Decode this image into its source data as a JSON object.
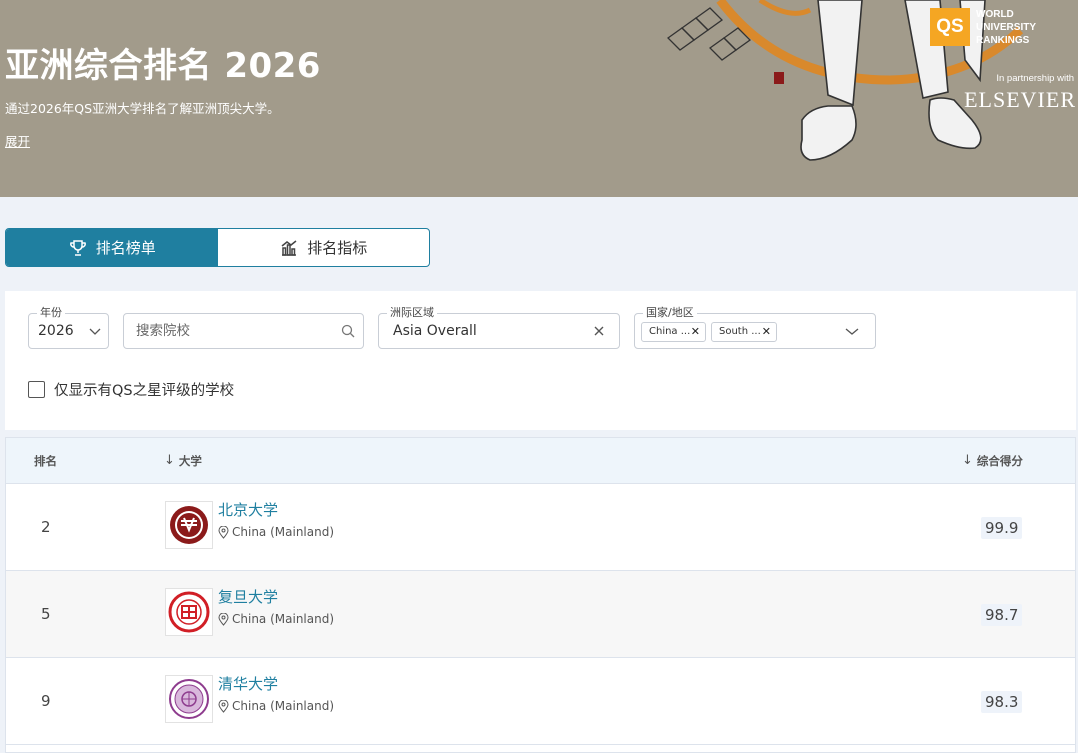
{
  "hero": {
    "title": "亚洲综合排名 2026",
    "description": "通过2026年QS亚洲大学排名了解亚洲顶尖大学。",
    "expand_label": "展开",
    "qs_logo": {
      "mark": "QS",
      "line1": "WORLD",
      "line2": "UNIVERSITY",
      "line3": "RANKINGS"
    },
    "partner_text": "In partnership with",
    "partner_name": "ELSEVIER"
  },
  "tabs": [
    {
      "label": "排名榜单",
      "icon": "trophy-icon",
      "active": true
    },
    {
      "label": "排名指标",
      "icon": "bar-chart-icon",
      "active": false
    }
  ],
  "filters": {
    "year": {
      "label": "年份",
      "value": "2026"
    },
    "search": {
      "placeholder": "搜索院校"
    },
    "region": {
      "label": "洲际区域",
      "value": "Asia Overall"
    },
    "country": {
      "label": "国家/地区",
      "chips": [
        "China ...",
        "South ..."
      ]
    },
    "star_checkbox_label": "仅显示有QS之星评级的学校"
  },
  "table": {
    "headers": {
      "rank": "排名",
      "university": "大学",
      "score": "综合得分"
    },
    "rows": [
      {
        "rank": "2",
        "name": "北京大学",
        "location": "China (Mainland)",
        "score": "99.9",
        "logo": "pku-seal-icon"
      },
      {
        "rank": "5",
        "name": "复旦大学",
        "location": "China (Mainland)",
        "score": "98.7",
        "logo": "fudan-seal-icon"
      },
      {
        "rank": "9",
        "name": "清华大学",
        "location": "China (Mainland)",
        "score": "98.3",
        "logo": "tsinghua-seal-icon"
      }
    ]
  },
  "colors": {
    "primary": "#1f7fa0",
    "hero_bg": "#a29b8b",
    "qs_orange": "#f5a623"
  }
}
